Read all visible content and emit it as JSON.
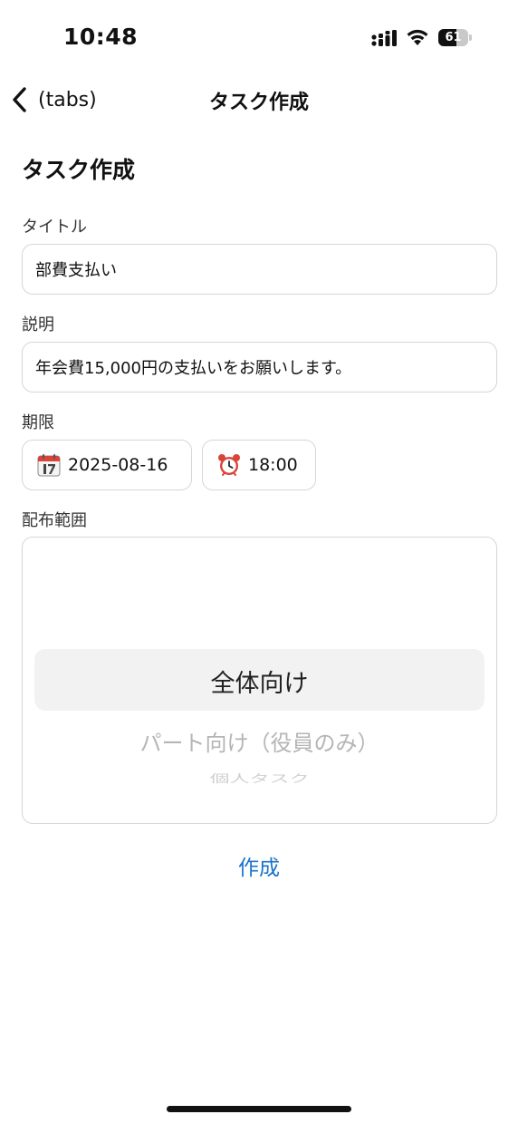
{
  "status_bar": {
    "time": "10:48",
    "battery_level": "61",
    "battery_percent": 61,
    "signal_icon": "signal-bars-icon",
    "wifi_icon": "wifi-icon"
  },
  "nav": {
    "back_label": "(tabs)",
    "title": "タスク作成",
    "back_icon": "chevron-left-icon"
  },
  "form": {
    "heading": "タスク作成",
    "title_label": "タイトル",
    "title_value": "部費支払い",
    "description_label": "説明",
    "description_value": "年会費15,000円の支払いをお願いします。",
    "deadline_label": "期限",
    "date_value": "2025-08-16",
    "date_icon": "calendar-icon",
    "time_value": "18:00",
    "time_icon": "alarm-clock-icon",
    "scope_label": "配布範囲",
    "scope_options": [
      "全体向け",
      "パート向け（役員のみ）",
      "個人タスク"
    ],
    "scope_selected": "全体向け",
    "submit_label": "作成"
  },
  "colors": {
    "accent": "#1a73c8",
    "border": "#d6d6d6",
    "picker_highlight": "#f2f2f2"
  }
}
